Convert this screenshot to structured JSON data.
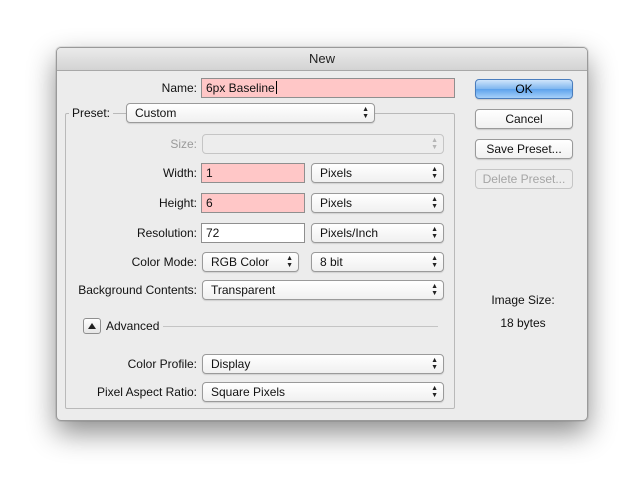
{
  "dialog": {
    "title": "New"
  },
  "name": {
    "label": "Name:",
    "value": "6px Baseline"
  },
  "preset": {
    "label": "Preset:",
    "value": "Custom"
  },
  "size": {
    "label": "Size:",
    "value": ""
  },
  "width": {
    "label": "Width:",
    "value": "1",
    "unit": "Pixels"
  },
  "height": {
    "label": "Height:",
    "value": "6",
    "unit": "Pixels"
  },
  "resolution": {
    "label": "Resolution:",
    "value": "72",
    "unit": "Pixels/Inch"
  },
  "color_mode": {
    "label": "Color Mode:",
    "value": "RGB Color",
    "depth": "8 bit"
  },
  "background": {
    "label": "Background Contents:",
    "value": "Transparent"
  },
  "advanced": {
    "label": "Advanced",
    "expanded": true
  },
  "color_profile": {
    "label": "Color Profile:",
    "value": "Display"
  },
  "pixel_aspect": {
    "label": "Pixel Aspect Ratio:",
    "value": "Square Pixels"
  },
  "buttons": {
    "ok": "OK",
    "cancel": "Cancel",
    "save_preset": "Save Preset...",
    "delete_preset": "Delete Preset..."
  },
  "image_size": {
    "label": "Image Size:",
    "value": "18 bytes"
  },
  "colors": {
    "invalid_field": "#ffc7c7",
    "default_button": "#6aa8ec"
  },
  "icons": {
    "popup_arrows": "up-down-arrows-icon",
    "disclosure": "disclosure-triangle-icon"
  }
}
